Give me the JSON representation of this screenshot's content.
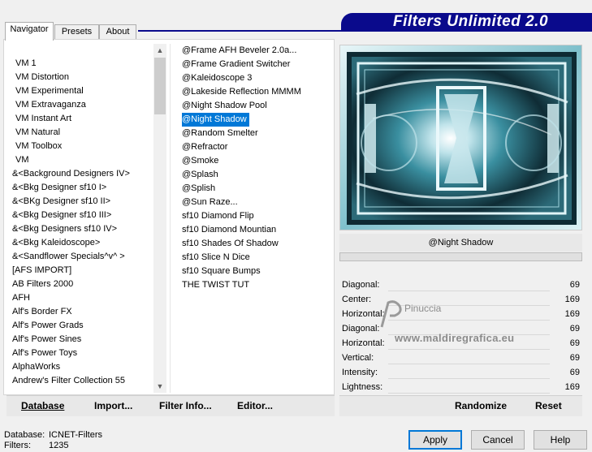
{
  "header": {
    "title": "Filters Unlimited 2.0"
  },
  "tabs": [
    {
      "label": "Navigator",
      "active": true
    },
    {
      "label": "Presets",
      "active": false
    },
    {
      "label": "About",
      "active": false
    }
  ],
  "categories": [
    "VM 1",
    "VM Distortion",
    "VM Experimental",
    "VM Extravaganza",
    "VM Instant Art",
    "VM Natural",
    "VM Toolbox",
    "VM",
    "&<Background Designers IV>",
    "&<Bkg Designer sf10 I>",
    "&<BKg Designer sf10 II>",
    "&<Bkg Designer sf10 III>",
    "&<Bkg Designers sf10 IV>",
    "&<Bkg Kaleidoscope>",
    "&<Sandflower Specials^v^ >",
    "[AFS IMPORT]",
    "AB Filters 2000",
    "AFH",
    "Alf's Border FX",
    "Alf's Power Grads",
    "Alf's Power Sines",
    "Alf's Power Toys",
    "AlphaWorks",
    "Andrew's Filter Collection 55"
  ],
  "filters": [
    "@Frame AFH Beveler 2.0a...",
    "@Frame Gradient Switcher",
    "@Kaleidoscope 3",
    "@Lakeside Reflection MMMM",
    "@Night Shadow Pool",
    "@Night Shadow",
    "@Random Smelter",
    "@Refractor",
    "@Smoke",
    "@Splash",
    "@Splish",
    "@Sun Raze...",
    "sf10 Diamond Flip",
    "sf10 Diamond Mountian",
    "sf10 Shades Of Shadow",
    "sf10 Slice N Dice",
    "sf10 Square Bumps",
    "THE TWIST TUT"
  ],
  "selected_filter_index": 5,
  "left_buttons": {
    "database": "Database",
    "import": "Import...",
    "filter_info": "Filter Info...",
    "editor": "Editor..."
  },
  "preview": {
    "caption": "@Night Shadow"
  },
  "sliders": [
    {
      "label": "Diagonal:",
      "value": "69"
    },
    {
      "label": "Center:",
      "value": "169"
    },
    {
      "label": "Horizontal:",
      "value": "169"
    },
    {
      "label": "Diagonal:",
      "value": "69"
    },
    {
      "label": "Horizontal:",
      "value": "69"
    },
    {
      "label": "Vertical:",
      "value": "69"
    },
    {
      "label": "Intensity:",
      "value": "69"
    },
    {
      "label": "Lightness:",
      "value": "169"
    }
  ],
  "right_buttons": {
    "randomize": "Randomize",
    "reset": "Reset"
  },
  "watermark": {
    "line1": "Pinuccia",
    "line2": "www.maldiregrafica.eu"
  },
  "status": {
    "database_label": "Database:",
    "database_value": "ICNET-Filters",
    "filters_label": "Filters:",
    "filters_value": "1235"
  },
  "dialog_buttons": {
    "apply": "Apply",
    "cancel": "Cancel",
    "help": "Help"
  },
  "colors": {
    "banner": "#0a0a8c",
    "selection": "#0078d7",
    "preview_teal": "#5fb5c4"
  }
}
